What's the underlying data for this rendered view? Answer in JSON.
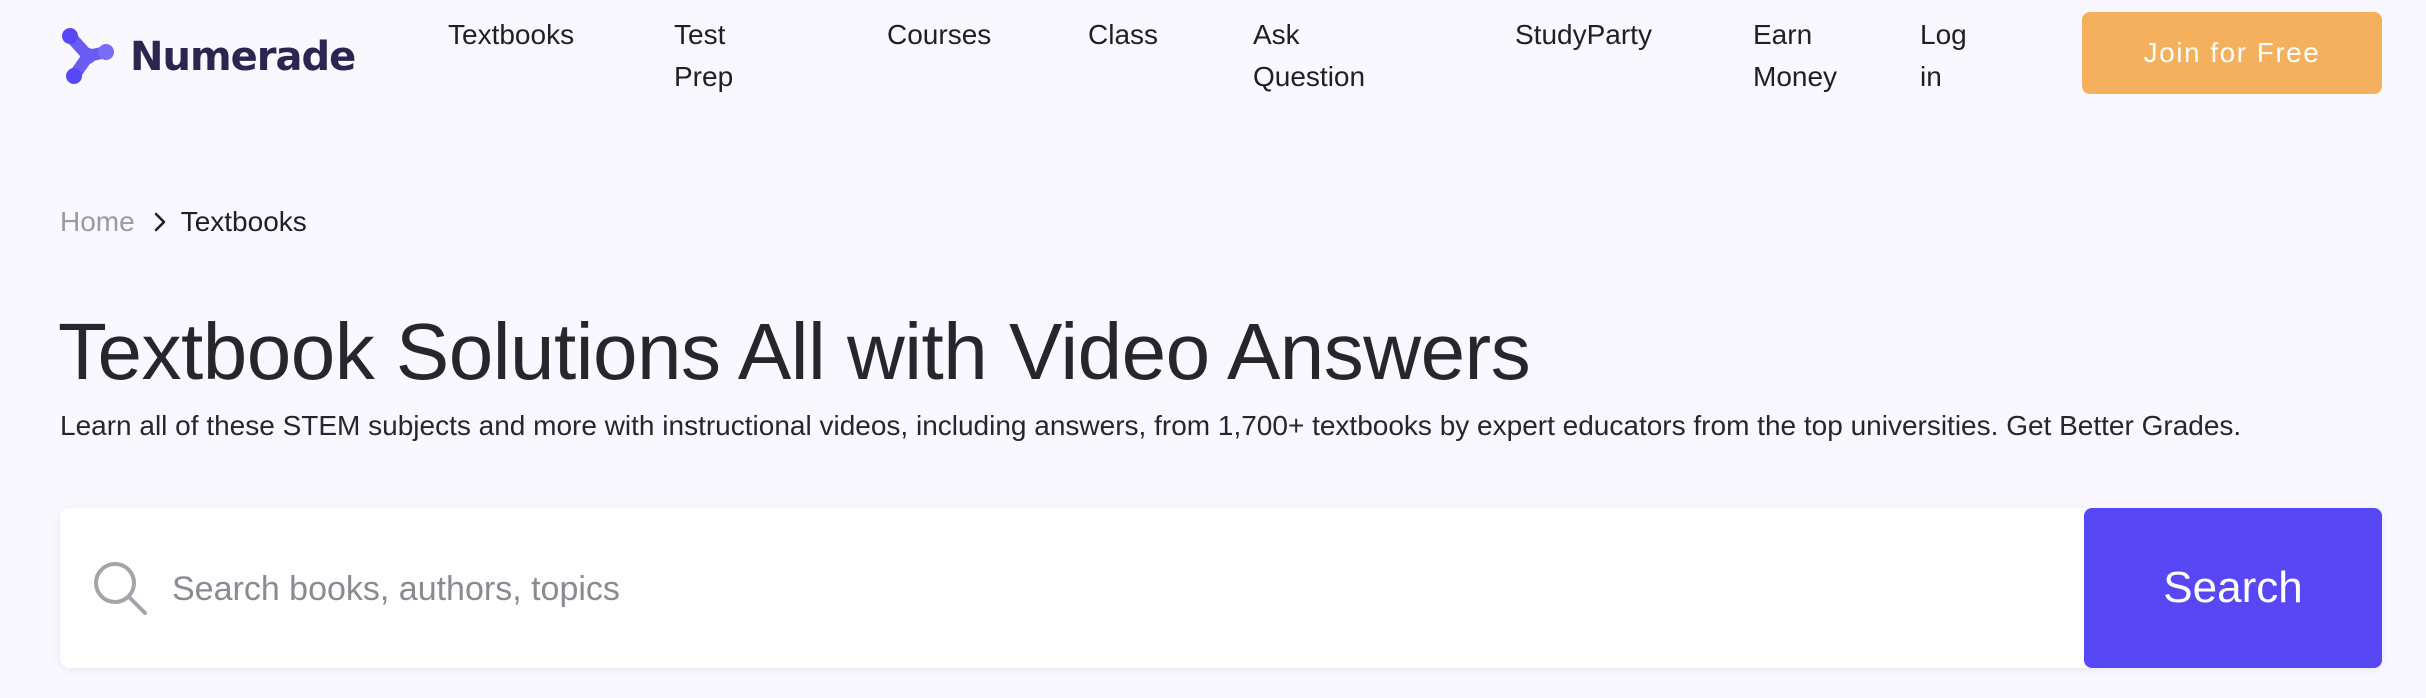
{
  "brand": {
    "name": "Numerade",
    "accent_color": "#5847f5",
    "logo_color": "#2b2550"
  },
  "nav": {
    "items": [
      {
        "label": "Textbooks"
      },
      {
        "label": "Test Prep"
      },
      {
        "label": "Courses"
      },
      {
        "label": "Class"
      },
      {
        "label": "Ask Question"
      },
      {
        "label": "StudyParty"
      },
      {
        "label": "Earn Money"
      },
      {
        "label": "Log in"
      }
    ],
    "join_label": "Join for Free",
    "join_color": "#f5b05d"
  },
  "breadcrumb": {
    "home": "Home",
    "current": "Textbooks",
    "separator_icon": "chevron-right-icon"
  },
  "hero": {
    "title": "Textbook Solutions All with Video Answers",
    "subtitle": "Learn all of these STEM subjects and more with instructional videos, including answers, from 1,700+ textbooks by expert educators from the top universities. Get Better Grades."
  },
  "search": {
    "icon": "search-icon",
    "placeholder": "Search books, authors, topics",
    "value": "",
    "button_label": "Search"
  }
}
